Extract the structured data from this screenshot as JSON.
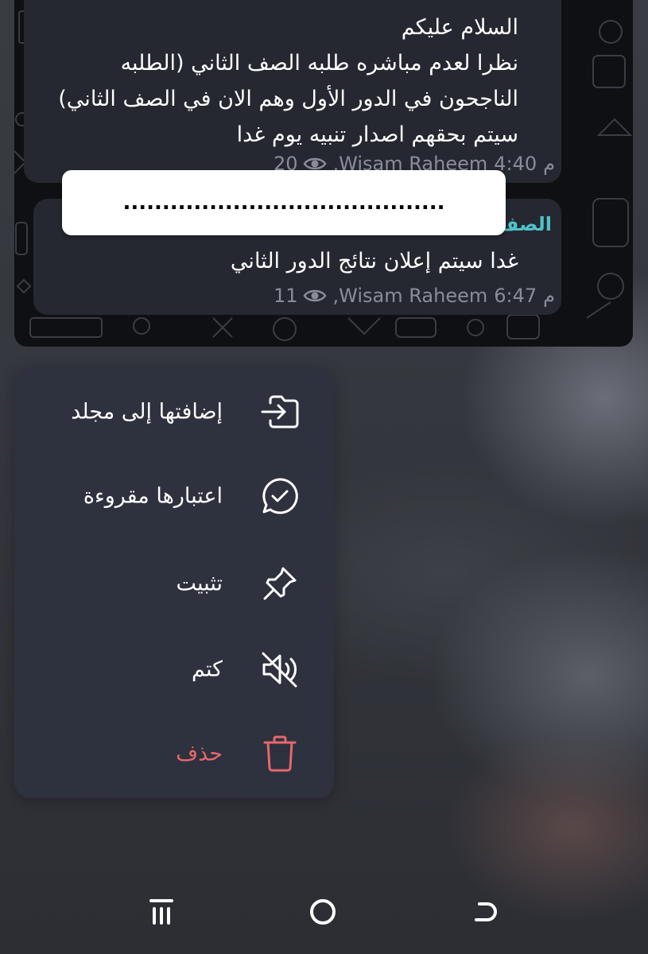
{
  "chat": {
    "post_1": {
      "text": "السلام عليكم\nنظرا لعدم مباشره طلبه الصف الثاني (الطلبه الناجحون في الدور الأول وهم الان في الصف الثاني) سيتم بحقهم  اصدار تنبيه يوم غدا",
      "views": "20",
      "author": "Wisam Raheem,",
      "time": "4:40",
      "time_suffix": "م"
    },
    "post_2": {
      "channel_title": "الصف",
      "text": "غدا سيتم إعلان نتائج الدور الثاني",
      "views": "11",
      "author": "Wisam Raheem,",
      "time": "6:47",
      "time_suffix": "م"
    },
    "redaction_dots": "........................................."
  },
  "context_menu": {
    "items": [
      {
        "label": "إضافتها إلى مجلد",
        "icon": "add-to-folder-icon"
      },
      {
        "label": "اعتبارها مقروءة",
        "icon": "mark-read-icon"
      },
      {
        "label": "تثبيت",
        "icon": "pin-icon"
      },
      {
        "label": "كتم",
        "icon": "mute-icon"
      },
      {
        "label": "حذف",
        "icon": "trash-icon",
        "color": "#e5686b"
      }
    ]
  },
  "navigation_bar": {
    "buttons": [
      "recent-apps-icon",
      "home-icon",
      "back-icon"
    ]
  },
  "colors": {
    "accent": "#4fc3c9",
    "bubble": "#262831",
    "menu_bg": "#2e313e",
    "danger": "#e5686b",
    "meta_text": "#8a8d98"
  }
}
